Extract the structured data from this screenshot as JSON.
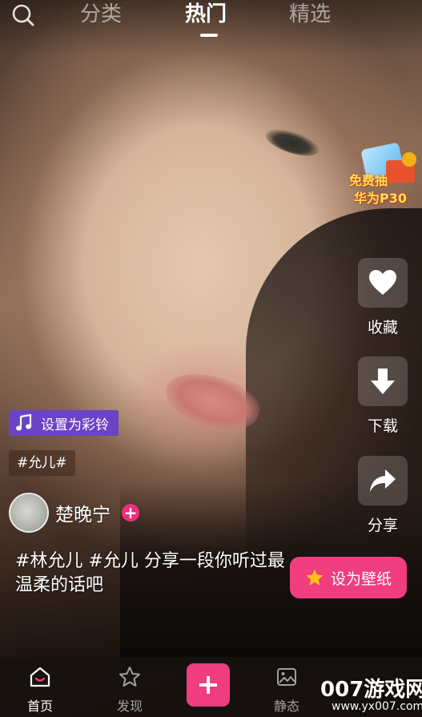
{
  "top_nav": {
    "tabs": [
      {
        "label": "分类",
        "active": false
      },
      {
        "label": "热门",
        "active": true
      },
      {
        "label": "精选",
        "active": false
      }
    ],
    "search_icon": "search-icon"
  },
  "promo": {
    "line1": "免费抽",
    "line2": "华为P30",
    "icon": "gift-prize-icon"
  },
  "actions": [
    {
      "label": "收藏",
      "icon": "heart-icon"
    },
    {
      "label": "下载",
      "icon": "download-arrow-icon"
    },
    {
      "label": "分享",
      "icon": "share-arrow-icon"
    }
  ],
  "ringtone": {
    "label": "设置为彩铃",
    "icon": "music-note-icon"
  },
  "tag": {
    "label": "#允儿#"
  },
  "author": {
    "name": "楚晚宁",
    "follow_icon": "plus-icon"
  },
  "caption": "#林允儿 #允儿 分享一段你听过最温柔的话吧",
  "wallpaper_button": {
    "label": "设为壁纸",
    "icon": "star-icon"
  },
  "bottom_nav": {
    "items": [
      {
        "label": "首页",
        "icon": "home-icon",
        "active": true
      },
      {
        "label": "发现",
        "icon": "star-outline-icon",
        "active": false
      },
      {
        "label": "静态",
        "icon": "image-icon",
        "active": false
      }
    ],
    "add_icon": "plus-icon"
  },
  "watermark": {
    "main": "007游戏网",
    "sub": "www.yx007.com"
  },
  "colors": {
    "accent_pink": "#ef3d80",
    "purple_chip": "#6b43c6",
    "follow_pink": "#ef2f7b"
  }
}
